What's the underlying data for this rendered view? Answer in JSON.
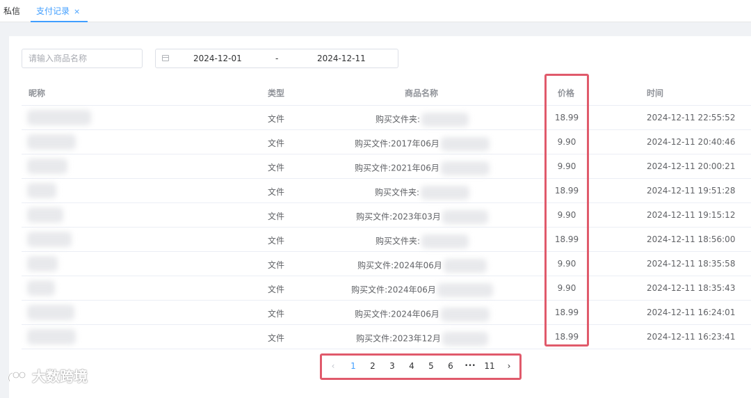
{
  "tabs": {
    "messages": "私信",
    "payment_records": "支付记录",
    "close_icon": "×"
  },
  "search": {
    "placeholder": "请输入商品名称",
    "value": ""
  },
  "date_range": {
    "start": "2024-12-01",
    "separator": "-",
    "end": "2024-12-11",
    "icon": "calendar-icon"
  },
  "table": {
    "headers": {
      "nickname": "昵称",
      "type": "类型",
      "product_name": "商品名称",
      "price": "价格",
      "time": "时间"
    },
    "rows": [
      {
        "type": "文件",
        "name": "购买文件夹:",
        "price": "18.99",
        "time": "2024-12-11 22:55:52"
      },
      {
        "type": "文件",
        "name": "购买文件:2017年06月",
        "price": "9.90",
        "time": "2024-12-11 20:40:46"
      },
      {
        "type": "文件",
        "name": "购买文件:2021年06月",
        "price": "9.90",
        "time": "2024-12-11 20:00:21"
      },
      {
        "type": "文件",
        "name": "购买文件夹:",
        "price": "18.99",
        "time": "2024-12-11 19:51:28"
      },
      {
        "type": "文件",
        "name": "购买文件:2023年03月",
        "price": "9.90",
        "time": "2024-12-11 19:15:12"
      },
      {
        "type": "文件",
        "name": "购买文件夹:",
        "price": "18.99",
        "time": "2024-12-11 18:56:00"
      },
      {
        "type": "文件",
        "name": "购买文件:2024年06月",
        "price": "9.90",
        "time": "2024-12-11 18:35:58"
      },
      {
        "type": "文件",
        "name": "购买文件:2024年06月",
        "price": "9.90",
        "time": "2024-12-11 18:35:43"
      },
      {
        "type": "文件",
        "name": "购买文件:2024年06月",
        "price": "18.99",
        "time": "2024-12-11 16:24:01"
      },
      {
        "type": "文件",
        "name": "购买文件:2023年12月",
        "price": "18.99",
        "time": "2024-12-11 16:23:41"
      }
    ]
  },
  "pagination": {
    "prev": "‹",
    "pages": [
      "1",
      "2",
      "3",
      "4",
      "5",
      "6"
    ],
    "ellipsis": "•••",
    "last": "11",
    "next": "›",
    "current": "1"
  },
  "watermark": {
    "text": "大数跨境"
  },
  "colors": {
    "accent": "#409eff",
    "highlight": "#e05a6b"
  }
}
